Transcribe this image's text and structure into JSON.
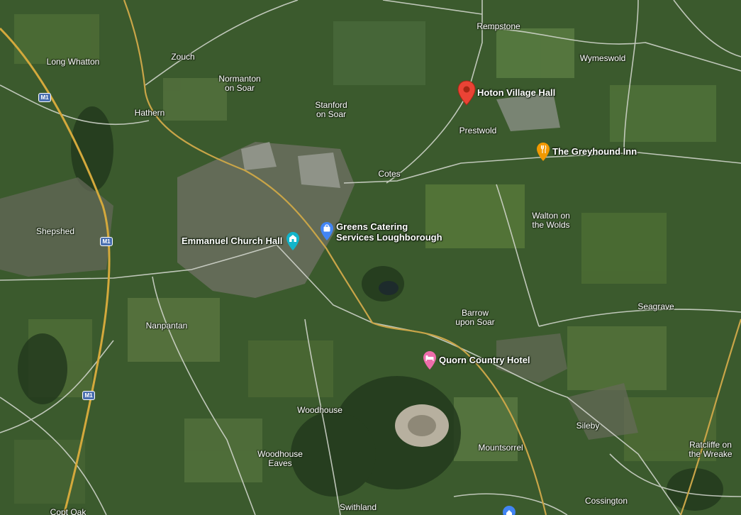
{
  "places": {
    "rempstone": "Rempstone",
    "wymeswold": "Wymeswold",
    "long_whatton": "Long Whatton",
    "zouch": "Zouch",
    "normanton_1": "Normanton",
    "normanton_2": "on Soar",
    "stanford_1": "Stanford",
    "stanford_2": "on Soar",
    "hathern": "Hathern",
    "prestwold": "Prestwold",
    "cotes": "Cotes",
    "shepshed": "Shepshed",
    "walton_1": "Walton on",
    "walton_2": "the Wolds",
    "seagrave": "Seagrave",
    "nanpantan": "Nanpantan",
    "barrow_1": "Barrow",
    "barrow_2": "upon Soar",
    "woodhouse": "Woodhouse",
    "woodhouse_eaves_1": "Woodhouse",
    "woodhouse_eaves_2": "Eaves",
    "sileby": "Sileby",
    "mountsorrel": "Mountsorrel",
    "ratcliffe_1": "Ratcliffe on",
    "ratcliffe_2": "the Wreake",
    "copt_oak": "Copt Oak",
    "swithland": "Swithland",
    "cossington": "Cossington"
  },
  "pois": {
    "hoton": {
      "label": "Hoton Village Hall",
      "icon": "location-pin-icon",
      "color": "#ea4335"
    },
    "greyhound": {
      "label": "The Greyhound Inn",
      "icon": "restaurant-icon",
      "color": "#f29900"
    },
    "greens_1": "Greens Catering",
    "greens_2": "Services Loughborough",
    "greens_icon": {
      "icon": "shopping-bag-icon",
      "color": "#4285f4"
    },
    "emmanuel": {
      "label": "Emmanuel Church Hall",
      "icon": "place-of-worship-icon",
      "color": "#12b5cb"
    },
    "quorn": {
      "label": "Quorn Country Hotel",
      "icon": "hotel-bed-icon",
      "color": "#ee6dab"
    }
  },
  "motorway": {
    "shield": "M1",
    "color": "#4a6fb0"
  }
}
